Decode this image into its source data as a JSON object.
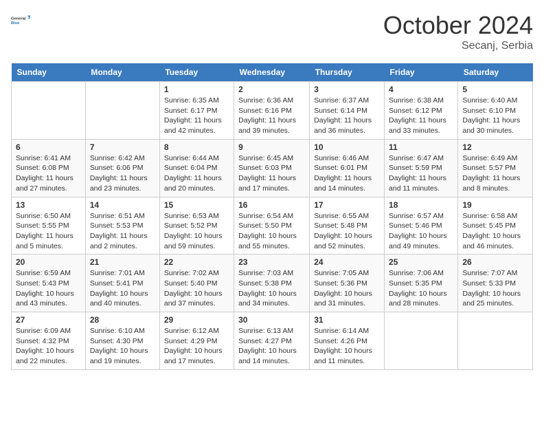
{
  "header": {
    "logo_general": "General",
    "logo_blue": "Blue",
    "month_title": "October 2024",
    "location": "Secanj, Serbia"
  },
  "days_of_week": [
    "Sunday",
    "Monday",
    "Tuesday",
    "Wednesday",
    "Thursday",
    "Friday",
    "Saturday"
  ],
  "weeks": [
    [
      null,
      null,
      {
        "day": "1",
        "sunrise": "6:35 AM",
        "sunset": "6:17 PM",
        "daylight": "11 hours and 42 minutes."
      },
      {
        "day": "2",
        "sunrise": "6:36 AM",
        "sunset": "6:16 PM",
        "daylight": "11 hours and 39 minutes."
      },
      {
        "day": "3",
        "sunrise": "6:37 AM",
        "sunset": "6:14 PM",
        "daylight": "11 hours and 36 minutes."
      },
      {
        "day": "4",
        "sunrise": "6:38 AM",
        "sunset": "6:12 PM",
        "daylight": "11 hours and 33 minutes."
      },
      {
        "day": "5",
        "sunrise": "6:40 AM",
        "sunset": "6:10 PM",
        "daylight": "11 hours and 30 minutes."
      }
    ],
    [
      {
        "day": "6",
        "sunrise": "6:41 AM",
        "sunset": "6:08 PM",
        "daylight": "11 hours and 27 minutes."
      },
      {
        "day": "7",
        "sunrise": "6:42 AM",
        "sunset": "6:06 PM",
        "daylight": "11 hours and 23 minutes."
      },
      {
        "day": "8",
        "sunrise": "6:44 AM",
        "sunset": "6:04 PM",
        "daylight": "11 hours and 20 minutes."
      },
      {
        "day": "9",
        "sunrise": "6:45 AM",
        "sunset": "6:03 PM",
        "daylight": "11 hours and 17 minutes."
      },
      {
        "day": "10",
        "sunrise": "6:46 AM",
        "sunset": "6:01 PM",
        "daylight": "11 hours and 14 minutes."
      },
      {
        "day": "11",
        "sunrise": "6:47 AM",
        "sunset": "5:59 PM",
        "daylight": "11 hours and 11 minutes."
      },
      {
        "day": "12",
        "sunrise": "6:49 AM",
        "sunset": "5:57 PM",
        "daylight": "11 hours and 8 minutes."
      }
    ],
    [
      {
        "day": "13",
        "sunrise": "6:50 AM",
        "sunset": "5:55 PM",
        "daylight": "11 hours and 5 minutes."
      },
      {
        "day": "14",
        "sunrise": "6:51 AM",
        "sunset": "5:53 PM",
        "daylight": "11 hours and 2 minutes."
      },
      {
        "day": "15",
        "sunrise": "6:53 AM",
        "sunset": "5:52 PM",
        "daylight": "10 hours and 59 minutes."
      },
      {
        "day": "16",
        "sunrise": "6:54 AM",
        "sunset": "5:50 PM",
        "daylight": "10 hours and 55 minutes."
      },
      {
        "day": "17",
        "sunrise": "6:55 AM",
        "sunset": "5:48 PM",
        "daylight": "10 hours and 52 minutes."
      },
      {
        "day": "18",
        "sunrise": "6:57 AM",
        "sunset": "5:46 PM",
        "daylight": "10 hours and 49 minutes."
      },
      {
        "day": "19",
        "sunrise": "6:58 AM",
        "sunset": "5:45 PM",
        "daylight": "10 hours and 46 minutes."
      }
    ],
    [
      {
        "day": "20",
        "sunrise": "6:59 AM",
        "sunset": "5:43 PM",
        "daylight": "10 hours and 43 minutes."
      },
      {
        "day": "21",
        "sunrise": "7:01 AM",
        "sunset": "5:41 PM",
        "daylight": "10 hours and 40 minutes."
      },
      {
        "day": "22",
        "sunrise": "7:02 AM",
        "sunset": "5:40 PM",
        "daylight": "10 hours and 37 minutes."
      },
      {
        "day": "23",
        "sunrise": "7:03 AM",
        "sunset": "5:38 PM",
        "daylight": "10 hours and 34 minutes."
      },
      {
        "day": "24",
        "sunrise": "7:05 AM",
        "sunset": "5:36 PM",
        "daylight": "10 hours and 31 minutes."
      },
      {
        "day": "25",
        "sunrise": "7:06 AM",
        "sunset": "5:35 PM",
        "daylight": "10 hours and 28 minutes."
      },
      {
        "day": "26",
        "sunrise": "7:07 AM",
        "sunset": "5:33 PM",
        "daylight": "10 hours and 25 minutes."
      }
    ],
    [
      {
        "day": "27",
        "sunrise": "6:09 AM",
        "sunset": "4:32 PM",
        "daylight": "10 hours and 22 minutes."
      },
      {
        "day": "28",
        "sunrise": "6:10 AM",
        "sunset": "4:30 PM",
        "daylight": "10 hours and 19 minutes."
      },
      {
        "day": "29",
        "sunrise": "6:12 AM",
        "sunset": "4:29 PM",
        "daylight": "10 hours and 17 minutes."
      },
      {
        "day": "30",
        "sunrise": "6:13 AM",
        "sunset": "4:27 PM",
        "daylight": "10 hours and 14 minutes."
      },
      {
        "day": "31",
        "sunrise": "6:14 AM",
        "sunset": "4:26 PM",
        "daylight": "10 hours and 11 minutes."
      },
      null,
      null
    ]
  ],
  "labels": {
    "sunrise": "Sunrise:",
    "sunset": "Sunset:",
    "daylight": "Daylight:"
  }
}
